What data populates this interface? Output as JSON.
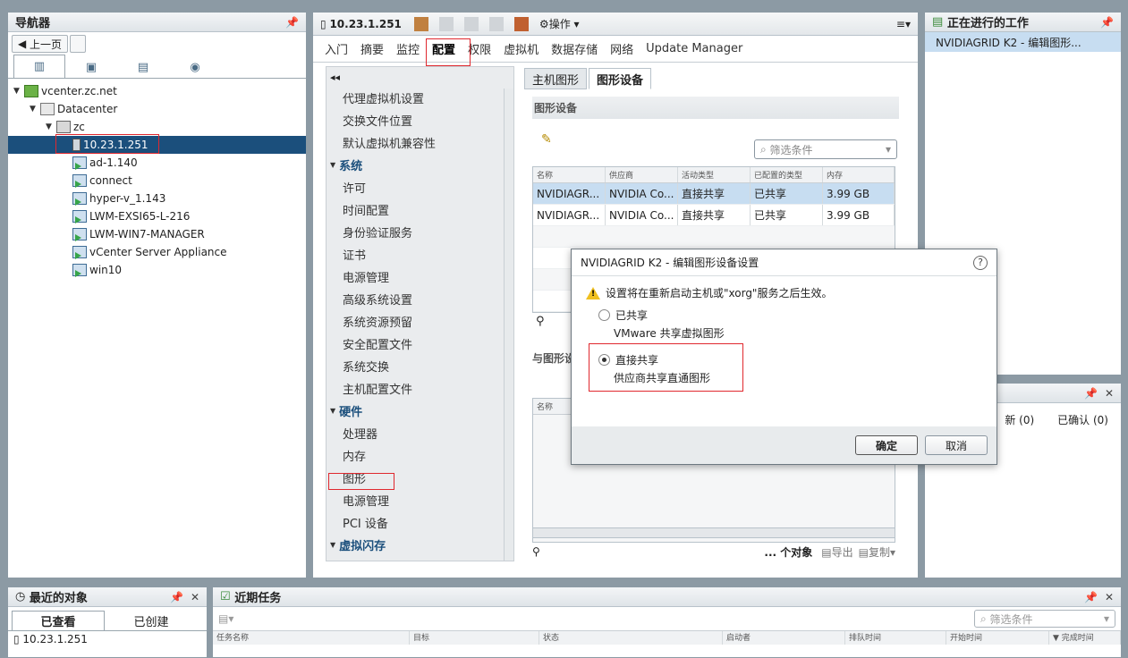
{
  "navigator": {
    "title": "导航器",
    "back_label": "上一页",
    "tabs": [
      "host-cluster-icon",
      "vm-template-icon",
      "datastore-icon",
      "network-icon"
    ],
    "tree": [
      {
        "label": "vcenter.zc.net",
        "indent": 0,
        "icon": "vc",
        "arrow": "▼"
      },
      {
        "label": "Datacenter",
        "indent": 1,
        "icon": "dc",
        "arrow": "▼"
      },
      {
        "label": "zc",
        "indent": 2,
        "icon": "cl",
        "arrow": "▼"
      },
      {
        "label": "10.23.1.251",
        "indent": 3,
        "icon": "host",
        "arrow": "",
        "selected": true
      },
      {
        "label": "ad-1.140",
        "indent": 3,
        "icon": "vm",
        "arrow": ""
      },
      {
        "label": "connect",
        "indent": 3,
        "icon": "vm",
        "arrow": ""
      },
      {
        "label": "hyper-v_1.143",
        "indent": 3,
        "icon": "vm",
        "arrow": ""
      },
      {
        "label": "LWM-EXSI65-L-216",
        "indent": 3,
        "icon": "vm",
        "arrow": ""
      },
      {
        "label": "LWM-WIN7-MANAGER",
        "indent": 3,
        "icon": "vm",
        "arrow": ""
      },
      {
        "label": "vCenter Server Appliance",
        "indent": 3,
        "icon": "vm",
        "arrow": ""
      },
      {
        "label": "win10",
        "indent": 3,
        "icon": "vm",
        "arrow": ""
      }
    ]
  },
  "main": {
    "host": "10.23.1.251",
    "actions_label": "操作",
    "tabs": [
      "入门",
      "摘要",
      "监控",
      "配置",
      "权限",
      "虚拟机",
      "数据存储",
      "网络",
      "Update Manager"
    ],
    "active_tab": "配置",
    "menu": [
      {
        "label": "代理虚拟机设置",
        "section": false
      },
      {
        "label": "交换文件位置",
        "section": false
      },
      {
        "label": "默认虚拟机兼容性",
        "section": false
      },
      {
        "label": "系统",
        "section": true
      },
      {
        "label": "许可",
        "section": false
      },
      {
        "label": "时间配置",
        "section": false
      },
      {
        "label": "身份验证服务",
        "section": false
      },
      {
        "label": "证书",
        "section": false
      },
      {
        "label": "电源管理",
        "section": false
      },
      {
        "label": "高级系统设置",
        "section": false
      },
      {
        "label": "系统资源预留",
        "section": false
      },
      {
        "label": "安全配置文件",
        "section": false
      },
      {
        "label": "系统交换",
        "section": false
      },
      {
        "label": "主机配置文件",
        "section": false
      },
      {
        "label": "硬件",
        "section": true
      },
      {
        "label": "处理器",
        "section": false
      },
      {
        "label": "内存",
        "section": false
      },
      {
        "label": "图形",
        "section": false
      },
      {
        "label": "电源管理",
        "section": false
      },
      {
        "label": "PCI 设备",
        "section": false
      },
      {
        "label": "虚拟闪存",
        "section": true
      }
    ],
    "subtabs": [
      "主机图形",
      "图形设备"
    ],
    "section_title": "图形设备",
    "filter_placeholder": "筛选条件",
    "columns": [
      "名称",
      "供应商",
      "活动类型",
      "已配置的类型",
      "内存"
    ],
    "rows": [
      [
        "NVIDIAGR...",
        "NVIDIA Co...",
        "直接共享",
        "已共享",
        "3.99 GB"
      ],
      [
        "NVIDIAGR...",
        "NVIDIA Co...",
        "直接共享",
        "已共享",
        "3.99 GB"
      ]
    ],
    "second_title": "与图形设",
    "second_col": "名称",
    "objects_label": "... 个对象",
    "export_label": "导出",
    "copy_label": "复制"
  },
  "work": {
    "title": "正在进行的工作",
    "item": "NVIDIAGRID K2 - 编辑图形..."
  },
  "alarms": {
    "new": "新 (0)",
    "ack": "已确认 (0)"
  },
  "recent": {
    "title": "最近的对象",
    "tabs": [
      "已查看",
      "已创建"
    ],
    "item": "10.23.1.251"
  },
  "tasks": {
    "title": "近期任务",
    "filter_placeholder": "筛选条件",
    "columns": [
      "任务名称",
      "目标",
      "状态",
      "启动者",
      "排队时间",
      "开始时间",
      "▼ 完成时间"
    ]
  },
  "dialog": {
    "title": "NVIDIAGRID K2 - 编辑图形设备设置",
    "warning": "设置将在重新启动主机或\"xorg\"服务之后生效。",
    "opt1": "已共享",
    "opt1_desc": "VMware 共享虚拟图形",
    "opt2": "直接共享",
    "opt2_desc": "供应商共享直通图形",
    "ok": "确定",
    "cancel": "取消"
  },
  "colors": {
    "selection": "#1b4f7c",
    "highlight": "#c7ddf1",
    "red_box": "#e0282e"
  }
}
